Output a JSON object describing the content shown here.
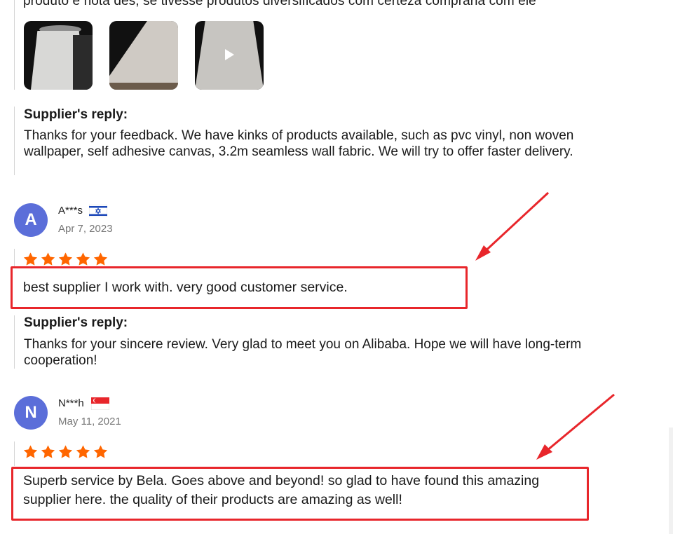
{
  "previous_review": {
    "text_fragment": "produto e nota des, se tivesse produtos diversificados com certeza compraria com ele",
    "media": [
      {
        "kind": "image",
        "icon": "photo"
      },
      {
        "kind": "image",
        "icon": "photo"
      },
      {
        "kind": "video",
        "icon": "play-icon"
      }
    ],
    "supplier_reply": {
      "title": "Supplier's reply:",
      "text": "Thanks for your feedback. We have kinks of products available, such as pvc vinyl, non woven wallpaper, self adhesive canvas, 3.2m seamless wall fabric. We will try to offer faster delivery."
    }
  },
  "reviews": [
    {
      "avatar_letter": "A",
      "username": "A***s",
      "country_flag": "Israel",
      "date": "Apr 7, 2023",
      "rating": 5,
      "text": "best supplier I work with. very good customer service.",
      "supplier_reply": {
        "title": "Supplier's reply:",
        "text": "Thanks for your sincere review. Very glad to meet you on Alibaba. Hope we will have long-term cooperation!"
      }
    },
    {
      "avatar_letter": "N",
      "username": "N***h",
      "country_flag": "Singapore",
      "date": "May 11, 2021",
      "rating": 5,
      "text": "Superb service by Bela. Goes above and beyond! so glad to have found this amazing supplier here. the quality of their products are amazing as well!"
    }
  ],
  "colors": {
    "star": "#ff6600",
    "avatar": "#5b6ed9",
    "highlight": "#e8262b"
  }
}
